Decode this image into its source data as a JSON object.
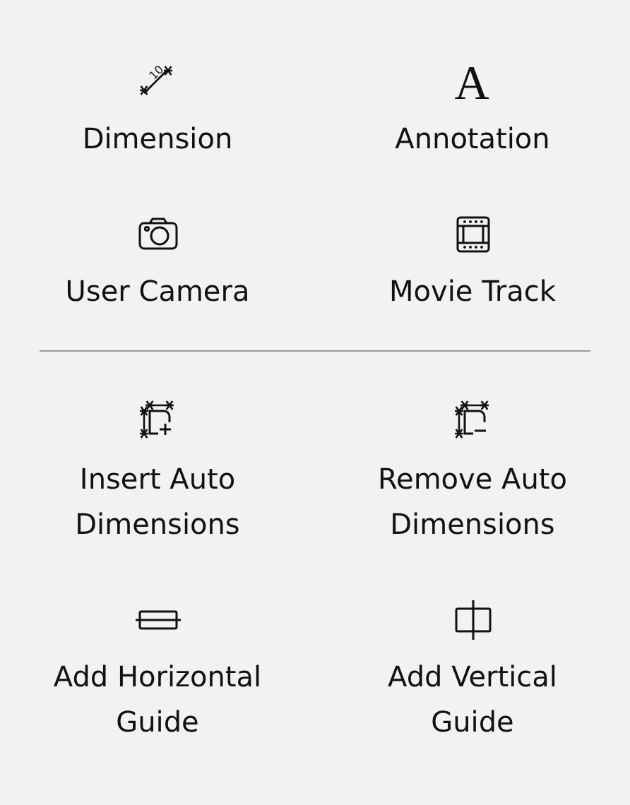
{
  "sections": [
    {
      "items": [
        {
          "kind": "dimension",
          "icon_text": "10",
          "label": "Dimension"
        },
        {
          "kind": "annotation",
          "icon_text": "A",
          "label": "Annotation"
        },
        {
          "kind": "camera",
          "label": "User Camera"
        },
        {
          "kind": "movie",
          "label": "Movie Track"
        }
      ]
    },
    {
      "items": [
        {
          "kind": "insert-auto",
          "label": "Insert Auto Dimensions"
        },
        {
          "kind": "remove-auto",
          "label": "Remove Auto Dimensions"
        },
        {
          "kind": "h-guide",
          "label": "Add Horizontal Guide"
        },
        {
          "kind": "v-guide",
          "label": "Add Vertical Guide"
        }
      ]
    }
  ]
}
